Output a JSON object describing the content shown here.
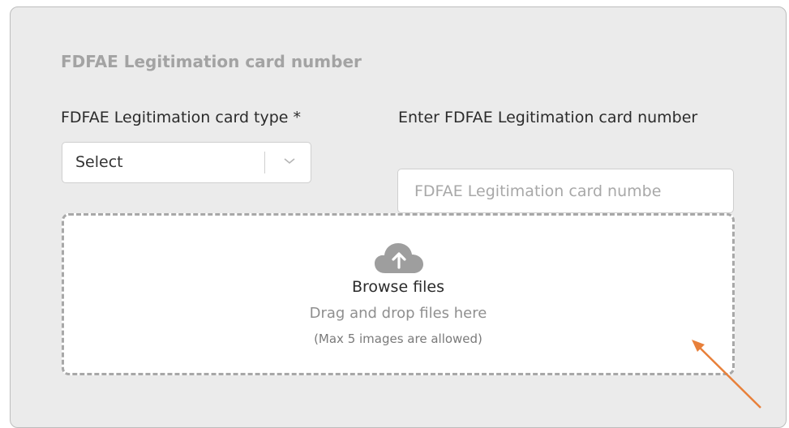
{
  "section": {
    "title": "FDFAE Legitimation card number"
  },
  "card_type": {
    "label": "FDFAE Legitimation card type *",
    "selected_value": "Select"
  },
  "card_number": {
    "label": "Enter FDFAE Legitimation card number",
    "placeholder": "FDFAE Legitimation card numbe",
    "value": ""
  },
  "upload": {
    "icon": "cloud-upload-icon",
    "browse_label": "Browse files",
    "drag_text": "Drag and drop files here",
    "limit_text": "(Max 5 images are allowed)"
  },
  "colors": {
    "panel_bg": "#ebebeb",
    "annotation_arrow": "#e8803a"
  }
}
